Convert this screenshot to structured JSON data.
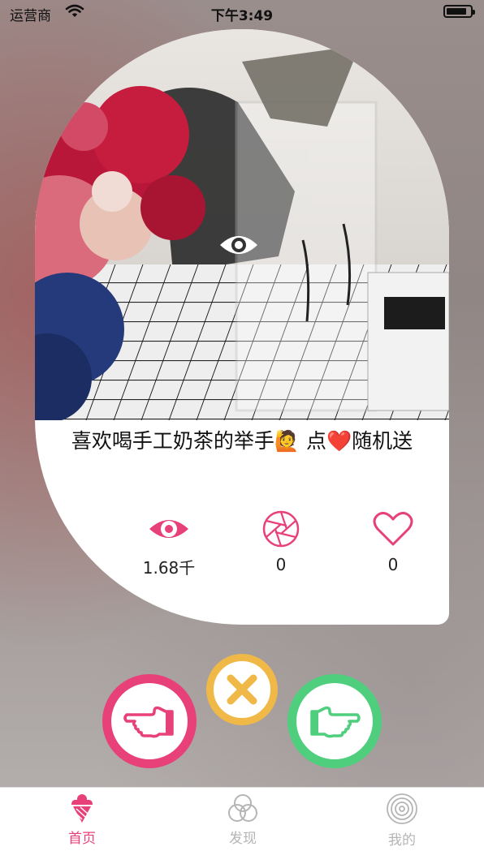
{
  "status_bar": {
    "carrier": "运营商",
    "time": "下午3:49",
    "battery_level": 0.85
  },
  "card": {
    "title": "喜欢喝手工奶茶的举手🙋 点❤️随机送",
    "stats": {
      "views": "1.68千",
      "shares": "0",
      "likes": "0"
    },
    "overlay_icon": "eye-icon"
  },
  "actions": {
    "dislike_icon": "thumb-point-left-icon",
    "skip_icon": "close-x-icon",
    "like_icon": "thumb-point-right-icon"
  },
  "tabbar": {
    "tabs": [
      {
        "label": "首页",
        "icon": "ice-cream-icon",
        "active": true
      },
      {
        "label": "发现",
        "icon": "circles-icon",
        "active": false
      },
      {
        "label": "我的",
        "icon": "concentric-circles-icon",
        "active": false
      }
    ]
  },
  "colors": {
    "accent_pink": "#e8417a",
    "accent_yellow": "#f0b847",
    "accent_green": "#4fcf7d",
    "tab_inactive": "#b5b5b5"
  }
}
